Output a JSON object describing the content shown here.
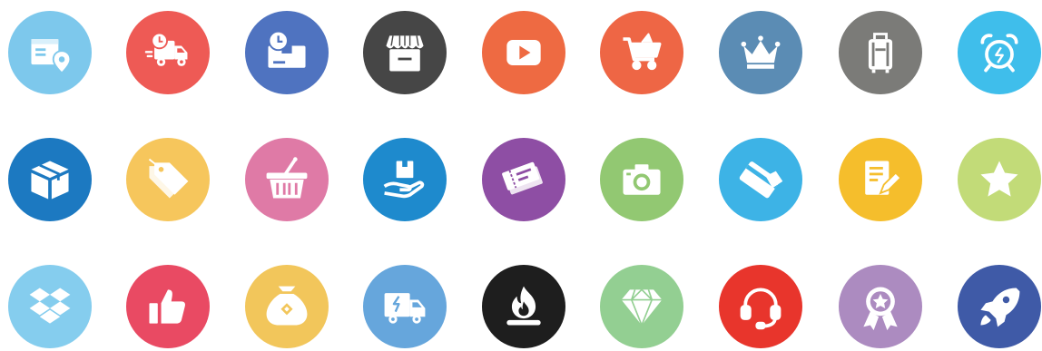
{
  "icons": [
    {
      "name": "parcel-location-icon",
      "color": "#7DC8EC"
    },
    {
      "name": "fast-delivery-truck-icon",
      "color": "#EE5A55"
    },
    {
      "name": "scheduled-package-icon",
      "color": "#4F73C0"
    },
    {
      "name": "storefront-icon",
      "color": "#464646"
    },
    {
      "name": "video-play-icon",
      "color": "#EE6A42"
    },
    {
      "name": "shopping-cart-icon",
      "color": "#EE6645"
    },
    {
      "name": "crown-icon",
      "color": "#5B8CB4"
    },
    {
      "name": "luggage-icon",
      "color": "#7B7B78"
    },
    {
      "name": "alarm-clock-icon",
      "color": "#3FBEEB"
    },
    {
      "name": "box-icon",
      "color": "#1C79C1"
    },
    {
      "name": "price-tags-icon",
      "color": "#F6C65C"
    },
    {
      "name": "shopping-basket-icon",
      "color": "#DF7AA6"
    },
    {
      "name": "package-hand-icon",
      "color": "#1E8ACD"
    },
    {
      "name": "tickets-icon",
      "color": "#8E4EA4"
    },
    {
      "name": "camera-icon",
      "color": "#92C872"
    },
    {
      "name": "credit-card-payment-icon",
      "color": "#3DB3E6"
    },
    {
      "name": "notes-edit-icon",
      "color": "#F5BE2C"
    },
    {
      "name": "star-icon",
      "color": "#C2DB78"
    },
    {
      "name": "dropbox-icon",
      "color": "#85CDEE"
    },
    {
      "name": "thumbs-up-icon",
      "color": "#E94A63"
    },
    {
      "name": "money-bag-icon",
      "color": "#F2C65B"
    },
    {
      "name": "delivery-van-icon",
      "color": "#66A6DC"
    },
    {
      "name": "flame-icon",
      "color": "#1E1E1E"
    },
    {
      "name": "diamond-icon",
      "color": "#93CF92"
    },
    {
      "name": "headset-support-icon",
      "color": "#E8352C"
    },
    {
      "name": "award-badge-icon",
      "color": "#AC8BC0"
    },
    {
      "name": "rocket-icon",
      "color": "#3F5AA7"
    }
  ]
}
